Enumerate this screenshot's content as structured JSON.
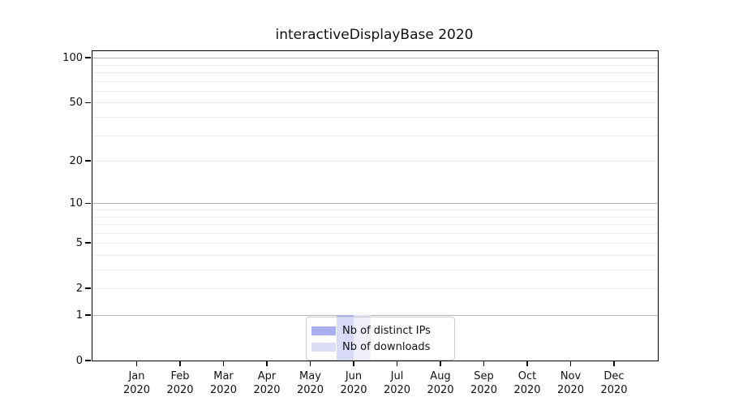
{
  "figure": {
    "background": "#ffffff"
  },
  "chart_data": {
    "type": "bar",
    "title": "interactiveDisplayBase 2020",
    "categories": [
      "Jan 2020",
      "Feb 2020",
      "Mar 2020",
      "Apr 2020",
      "May 2020",
      "Jun 2020",
      "Jul 2020",
      "Aug 2020",
      "Sep 2020",
      "Oct 2020",
      "Nov 2020",
      "Dec 2020"
    ],
    "x_tick_line1": [
      "Jan",
      "Feb",
      "Mar",
      "Apr",
      "May",
      "Jun",
      "Jul",
      "Aug",
      "Sep",
      "Oct",
      "Nov",
      "Dec"
    ],
    "x_tick_line2": "2020",
    "series": [
      {
        "name": "Nb of distinct IPs",
        "color": "#a9aeee",
        "values": [
          0,
          0,
          0,
          0,
          0,
          1,
          0,
          0,
          0,
          0,
          0,
          0
        ]
      },
      {
        "name": "Nb of downloads",
        "color": "#dcdef6",
        "values": [
          0,
          0,
          0,
          0,
          0,
          1,
          0,
          0,
          0,
          0,
          0,
          0
        ]
      }
    ],
    "y_axis": {
      "scale": "log1p",
      "tick_values": [
        0,
        1,
        2,
        5,
        10,
        20,
        50,
        100
      ],
      "tick_labels": [
        "0",
        "1",
        "2",
        "5",
        "10",
        "20",
        "50",
        "100"
      ],
      "gridlines_strong": [
        1,
        10,
        100
      ],
      "gridlines_light": [
        2,
        3,
        4,
        5,
        6,
        7,
        8,
        9,
        20,
        30,
        40,
        50,
        60,
        70,
        80,
        90
      ],
      "ylim": [
        0,
        112
      ]
    },
    "grid": true,
    "legend_position": "bottom-center"
  },
  "colors": {
    "spine": "#000000",
    "grid_strong": "#b4b4b4",
    "grid_light": "#ebebeb",
    "legend_border": "#cccccc",
    "text": "#111111"
  }
}
